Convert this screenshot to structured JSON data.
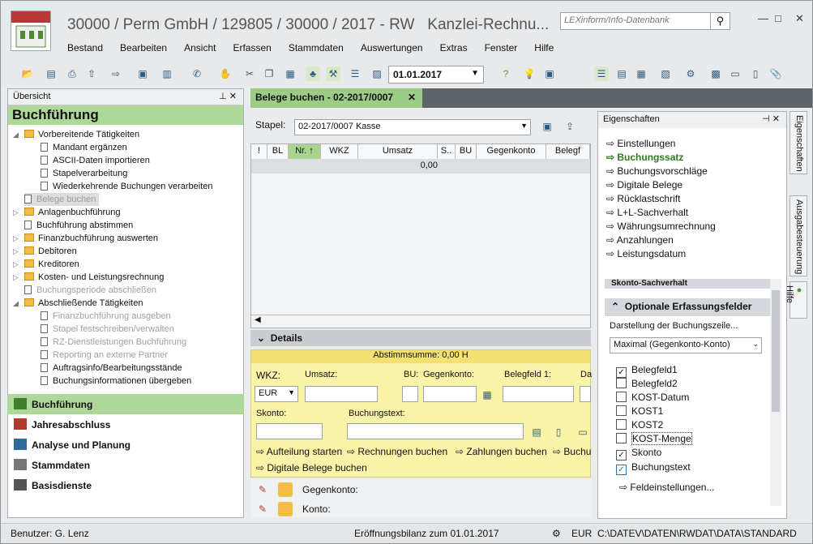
{
  "title": {
    "text": "30000 / Perm GmbH / 129805 / 30000 / 2017 - RW",
    "kanzlei": "Kanzlei-Rechnu...",
    "search_placeholder": "LEXinform/Info-Datenbank"
  },
  "menu": [
    "Bestand",
    "Bearbeiten",
    "Ansicht",
    "Erfassen",
    "Stammdaten",
    "Auswertungen",
    "Extras",
    "Fenster",
    "Hilfe"
  ],
  "toolbar": {
    "date": "01.01.2017"
  },
  "left": {
    "header": "Übersicht",
    "title": "Buchführung",
    "tree": [
      "Vorbereitende Tätigkeiten",
      "Mandant ergänzen",
      "ASCII-Daten importieren",
      "Stapelverarbeitung",
      "Wiederkehrende Buchungen verarbeiten",
      "Belege buchen",
      "Anlagenbuchführung",
      "Buchführung abstimmen",
      "Finanzbuchführung auswerten",
      "Debitoren",
      "Kreditoren",
      "Kosten- und Leistungsrechnung",
      "Buchungsperiode abschließen",
      "Abschließende Tätigkeiten",
      "Finanzbuchführung ausgeben",
      "Stapel festschreiben/verwalten",
      "RZ-Dienstleistungen Buchführung",
      "Reporting an externe Partner",
      "Auftragsinfo/Bearbeitungsstände",
      "Buchungsinformationen übergeben"
    ],
    "nav": [
      "Buchführung",
      "Jahresabschluss",
      "Analyse und Planung",
      "Stammdaten",
      "Basisdienste"
    ]
  },
  "main": {
    "tab": "Belege buchen - 02-2017/0007",
    "stapel_label": "Stapel:",
    "stapel_value": "02-2017/0007  Kasse",
    "columns": [
      "!",
      "BL",
      "Nr.",
      "WKZ",
      "Umsatz",
      "S..",
      "BU",
      "Gegenkonto",
      "Belegf"
    ],
    "sum": "0,00",
    "details": "Details",
    "abstimmsumme": "Abstimmsumme: 0,00 H",
    "labels": {
      "wkz": "WKZ:",
      "umsatz": "Umsatz:",
      "bu": "BU:",
      "gegenkonto": "Gegenkonto:",
      "belegfeld1": "Belegfeld 1:",
      "da": "Da",
      "skonto": "Skonto:",
      "buchungstext": "Buchungstext:"
    },
    "wkz_value": "EUR",
    "links": [
      "Aufteilung starten",
      "Rechnungen buchen",
      "Zahlungen buchen",
      "Buchu",
      "Digitale Belege buchen"
    ],
    "bottom": [
      "Gegenkonto:",
      "Konto:"
    ]
  },
  "right": {
    "header": "Eigenschaften",
    "items": [
      "Einstellungen",
      "Buchungssatz",
      "Buchungsvorschläge",
      "Digitale Belege",
      "Rücklastschrift",
      "L+L-Sachverhalt",
      "Währungsumrechnung",
      "Anzahlungen",
      "Leistungsdatum"
    ],
    "hidden_section": "Skonto-Sachverhalt",
    "section": "Optionale Erfassungsfelder",
    "darstellung": "Darstellung der Buchungszeile...",
    "darstellung_value": "Maximal (Gegenkonto-Konto)",
    "checks": [
      {
        "label": "Belegfeld1",
        "checked": true
      },
      {
        "label": "Belegfeld2",
        "checked": false
      },
      {
        "label": "KOST-Datum",
        "checked": false
      },
      {
        "label": "KOST1",
        "checked": false
      },
      {
        "label": "KOST2",
        "checked": false
      },
      {
        "label": "KOST-Menge",
        "checked": false
      },
      {
        "label": "Skonto",
        "checked": true
      },
      {
        "label": "Buchungstext",
        "checked": true
      }
    ],
    "feldeinstellungen": "Feldeinstellungen..."
  },
  "side_tabs": [
    "Eigenschaften",
    "Ausgabesteuerung",
    "Hilfe"
  ],
  "status": {
    "user": "Benutzer: G. Lenz",
    "bilanz": "Eröffnungsbilanz zum 01.01.2017",
    "currency": "EUR",
    "path": "C:\\DATEV\\DATEN\\RWDAT\\DATA\\STANDARD"
  }
}
